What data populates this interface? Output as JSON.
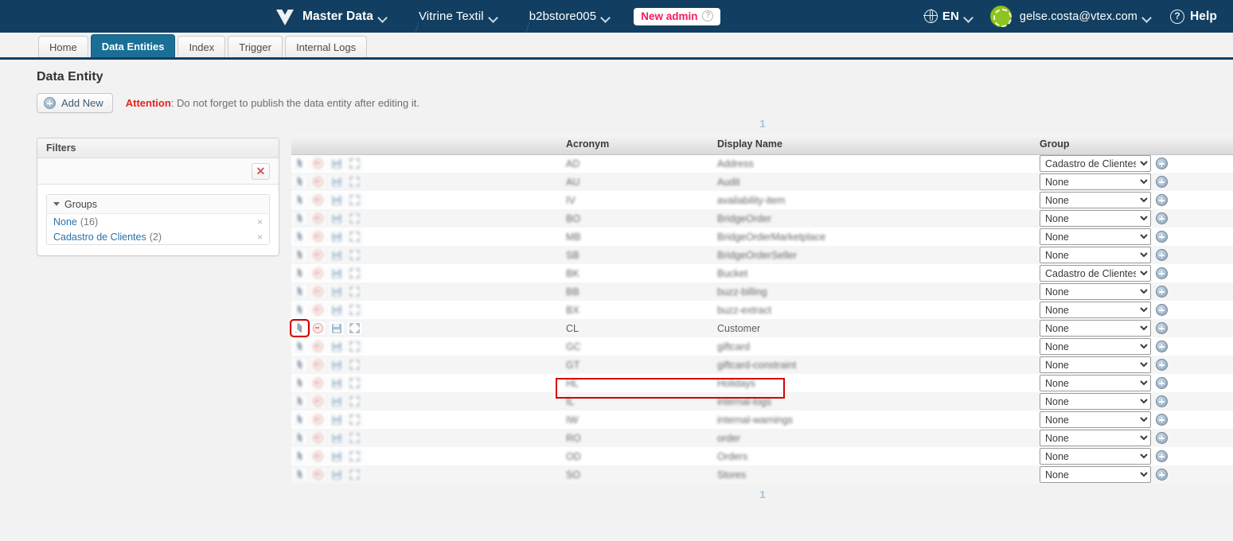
{
  "topbar": {
    "logo_icon": "vtex-logo-icon",
    "app_name": "Master Data",
    "account_name": "Vitrine Textil",
    "store_name": "b2bstore005",
    "new_admin_badge": "New admin",
    "new_admin_help_icon": "question-mark-icon",
    "language": "EN",
    "language_icon": "globe-icon",
    "avatar_icon": "user-avatar-icon",
    "user_email": "gelse.costa@vtex.com",
    "help_label": "Help",
    "help_icon": "question-mark-icon",
    "caret_icon": "chevron-down-icon"
  },
  "tabs": [
    {
      "label": "Home",
      "active": false
    },
    {
      "label": "Data Entities",
      "active": true
    },
    {
      "label": "Index",
      "active": false
    },
    {
      "label": "Trigger",
      "active": false
    },
    {
      "label": "Internal Logs",
      "active": false
    }
  ],
  "page": {
    "title": "Data Entity",
    "add_new_label": "Add New",
    "add_new_icon": "plus-circle-icon",
    "attention_label": "Attention",
    "attention_message": ": Do not forget to publish the data entity after editing it."
  },
  "filters": {
    "header": "Filters",
    "clear_icon": "red-x-icon",
    "clear_label": "✕",
    "groups_section_label": "Groups",
    "collapse_icon": "triangle-down-icon",
    "items": [
      {
        "name": "None",
        "count": "(16)",
        "remove_icon": "close-small-icon",
        "remove_label": "×"
      },
      {
        "name": "Cadastro de Clientes",
        "count": "(2)",
        "remove_icon": "close-small-icon",
        "remove_label": "×"
      }
    ]
  },
  "pagination": {
    "top": "1",
    "bottom": "1"
  },
  "table": {
    "columns": [
      "",
      "",
      "Acronym",
      "Display Name",
      "Group"
    ],
    "headers": {
      "actions": "",
      "spacer": "",
      "acronym": "Acronym",
      "display_name": "Display Name",
      "group": "Group"
    },
    "row_actions": {
      "edit_icon": "pencil-edit-icon",
      "delete_icon": "minus-circle-delete-icon",
      "save_icon": "floppy-save-icon",
      "expand_icon": "expand-arrows-icon",
      "add_group_icon": "plus-circle-icon"
    },
    "group_options": [
      "None",
      "Cadastro de Clientes"
    ],
    "rows": [
      {
        "acronym": "AD",
        "display_name": "Address",
        "group": "Cadastro de Clientes",
        "blurred": true,
        "highlighted": false
      },
      {
        "acronym": "AU",
        "display_name": "Audit",
        "group": "None",
        "blurred": true,
        "highlighted": false
      },
      {
        "acronym": "IV",
        "display_name": "availability-item",
        "group": "None",
        "blurred": true,
        "highlighted": false
      },
      {
        "acronym": "BO",
        "display_name": "BridgeOrder",
        "group": "None",
        "blurred": true,
        "highlighted": false
      },
      {
        "acronym": "MB",
        "display_name": "BridgeOrderMarketplace",
        "group": "None",
        "blurred": true,
        "highlighted": false
      },
      {
        "acronym": "SB",
        "display_name": "BridgeOrderSeller",
        "group": "None",
        "blurred": true,
        "highlighted": false
      },
      {
        "acronym": "BK",
        "display_name": "Bucket",
        "group": "Cadastro de Clientes",
        "blurred": true,
        "highlighted": false
      },
      {
        "acronym": "BB",
        "display_name": "buzz-billing",
        "group": "None",
        "blurred": true,
        "highlighted": false
      },
      {
        "acronym": "BX",
        "display_name": "buzz-extract",
        "group": "None",
        "blurred": true,
        "highlighted": false
      },
      {
        "acronym": "CL",
        "display_name": "Customer",
        "group": "None",
        "blurred": false,
        "highlighted": true
      },
      {
        "acronym": "GC",
        "display_name": "giftcard",
        "group": "None",
        "blurred": true,
        "highlighted": false
      },
      {
        "acronym": "GT",
        "display_name": "giftcard-constraint",
        "group": "None",
        "blurred": true,
        "highlighted": false
      },
      {
        "acronym": "HL",
        "display_name": "Holidays",
        "group": "None",
        "blurred": true,
        "highlighted": false
      },
      {
        "acronym": "IL",
        "display_name": "internal-logs",
        "group": "None",
        "blurred": true,
        "highlighted": false
      },
      {
        "acronym": "IW",
        "display_name": "internal-warnings",
        "group": "None",
        "blurred": true,
        "highlighted": false
      },
      {
        "acronym": "RO",
        "display_name": "order",
        "group": "None",
        "blurred": true,
        "highlighted": false
      },
      {
        "acronym": "OD",
        "display_name": "Orders",
        "group": "None",
        "blurred": true,
        "highlighted": false
      },
      {
        "acronym": "SO",
        "display_name": "Stores",
        "group": "None",
        "blurred": true,
        "highlighted": false
      }
    ]
  },
  "colors": {
    "nav_bg": "#123f61",
    "active_tab": "#1a6f96",
    "accent_pink": "#f71963",
    "warning_red": "#e8221c",
    "highlight_red": "#d60000",
    "link_blue": "#2a72a8",
    "avatar_green": "#8ec320",
    "page_bg": "#f2f2f2"
  }
}
